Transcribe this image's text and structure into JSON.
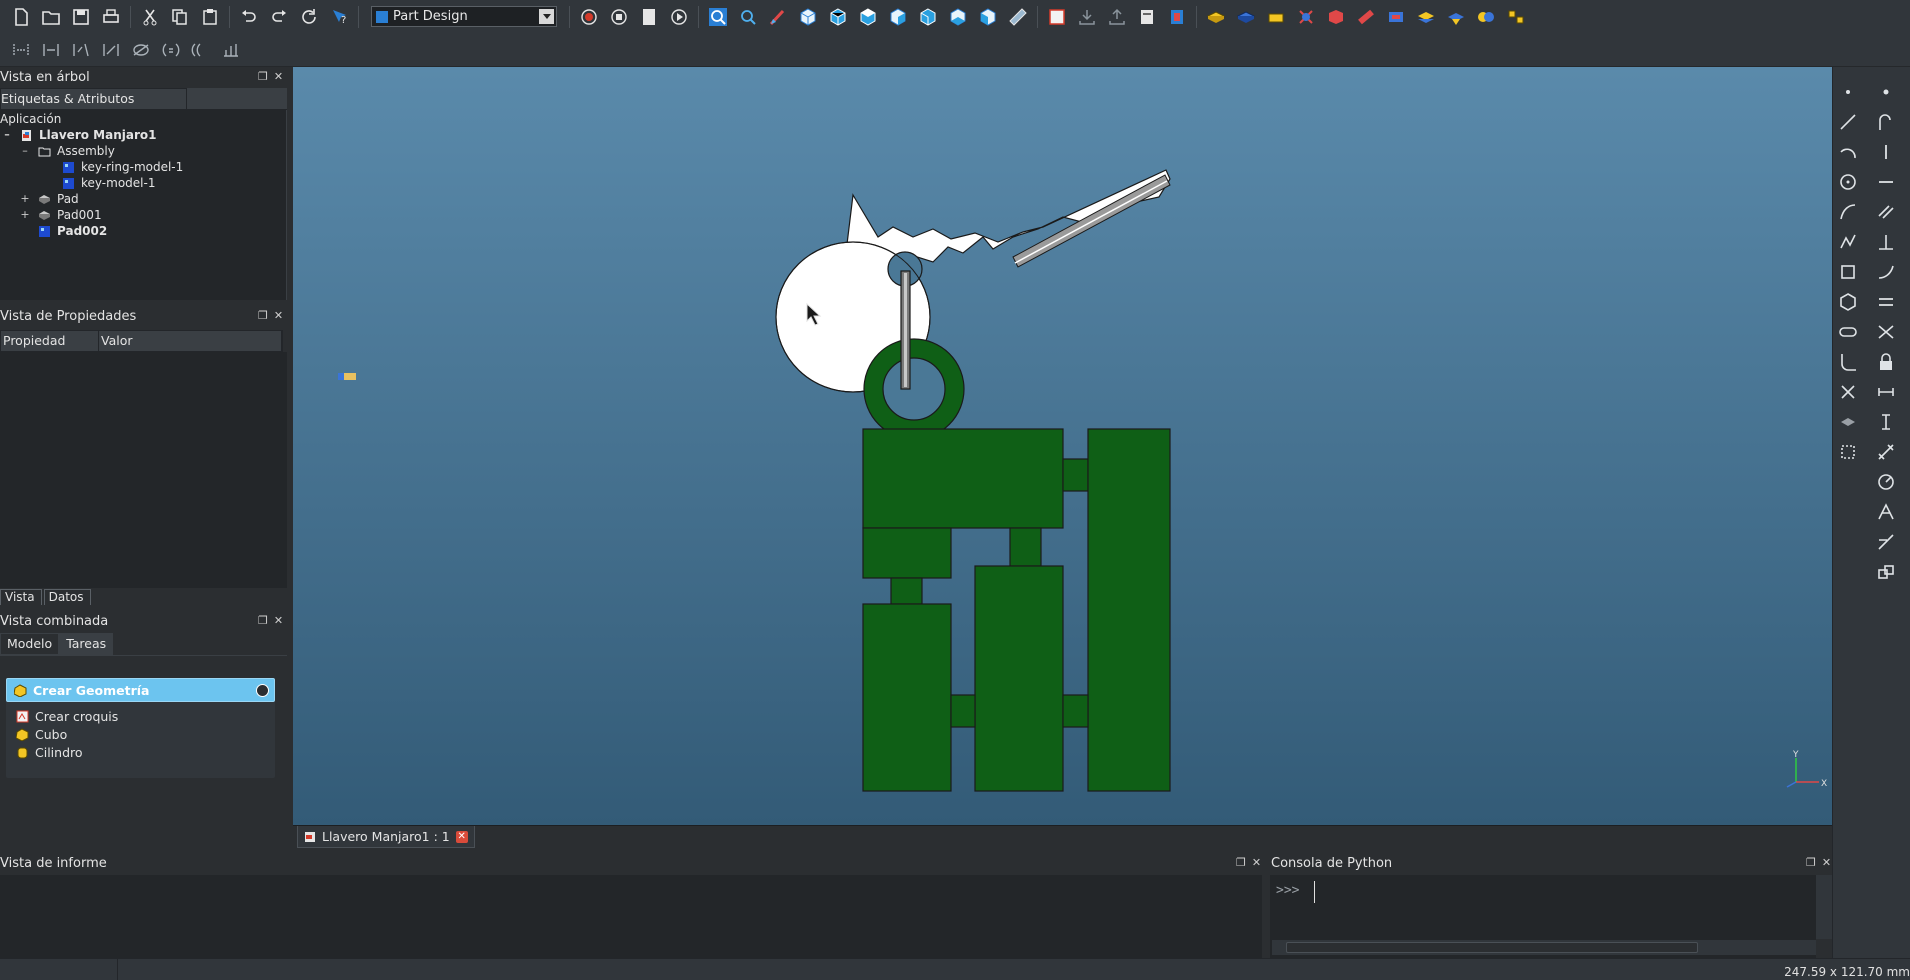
{
  "toolbar": {
    "workbench": "Part Design"
  },
  "tree_view": {
    "title": "Vista en árbol",
    "tab": "Etiquetas & Atributos",
    "root": "Aplicación",
    "document": "Llavero Manjaro1",
    "items": [
      {
        "label": "Assembly",
        "expander": "–"
      },
      {
        "label": "key-ring-model-1"
      },
      {
        "label": "key-model-1"
      },
      {
        "label": "Pad",
        "expander": "+"
      },
      {
        "label": "Pad001",
        "expander": "+"
      },
      {
        "label": "Pad002"
      }
    ],
    "document_expander": "–"
  },
  "properties": {
    "title": "Vista de Propiedades",
    "col_property": "Propiedad",
    "col_value": "Valor",
    "tab_view": "Vista",
    "tab_data": "Datos"
  },
  "combo_view": {
    "title": "Vista combinada",
    "tab_model": "Modelo",
    "tab_tasks": "Tareas",
    "task_header": "Crear Geometría",
    "tasks": [
      "Crear croquis",
      "Cubo",
      "Cilindro"
    ]
  },
  "viewport": {
    "tab_label": "Llavero Manjaro1 : 1",
    "axis_x": "X",
    "axis_y": "Y"
  },
  "report_view": {
    "title": "Vista de informe"
  },
  "python_console": {
    "title": "Consola de Python",
    "prompt": ">>>"
  },
  "status": {
    "dimensions": "247.59 x 121.70 mm"
  },
  "colors": {
    "model_green": "#0f5f16",
    "key_white": "#ffffff",
    "task_header": "#6cc4ef"
  }
}
